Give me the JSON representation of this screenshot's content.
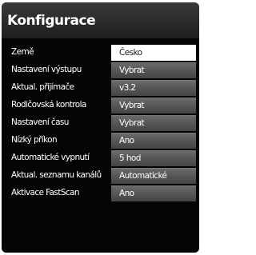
{
  "dialog": {
    "title": "Konfigurace"
  },
  "settings": [
    {
      "label": "Země",
      "value": "Česko",
      "selected": true
    },
    {
      "label": "Nastavení výstupu",
      "value": "Vybrat",
      "selected": false
    },
    {
      "label": "Aktual. přijímače",
      "value": "v3.2",
      "selected": false
    },
    {
      "label": "Rodičovská kontrola",
      "value": "Vybrat",
      "selected": false
    },
    {
      "label": "Nastavení času",
      "value": "Vybrat",
      "selected": false
    },
    {
      "label": "Nízký příkon",
      "value": "Ano",
      "selected": false
    },
    {
      "label": "Automatické vypnutí",
      "value": "5 hod",
      "selected": false
    },
    {
      "label": "Aktual. seznamu kanálů",
      "value": "Automatické",
      "selected": false
    },
    {
      "label": "Aktivace FastScan",
      "value": "Ano",
      "selected": false
    }
  ]
}
